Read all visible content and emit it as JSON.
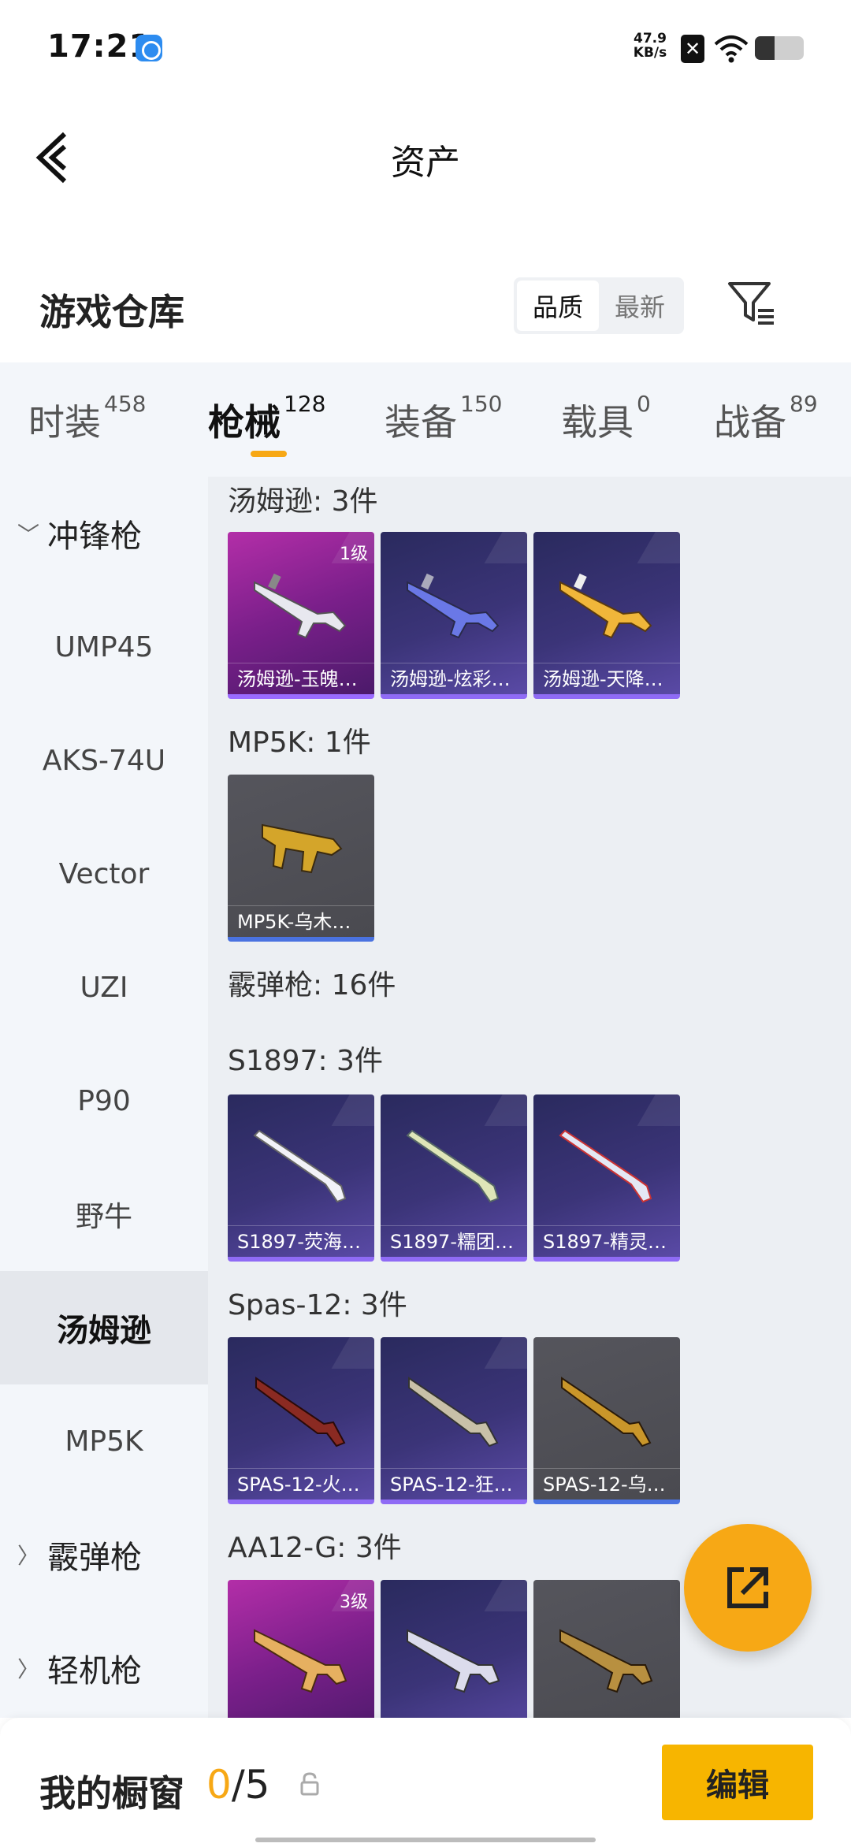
{
  "status_bar": {
    "time": "17:21",
    "speed_value": "47.9",
    "speed_unit": "KB/s",
    "icons": [
      "app-icon",
      "x-icon",
      "wifi-icon",
      "battery-icon"
    ]
  },
  "header": {
    "title": "资产",
    "back_icon": "chevron-left-icon"
  },
  "warehouse": {
    "title": "游戏仓库",
    "sort_options": [
      "品质",
      "最新"
    ],
    "sort_selected": "品质",
    "filter_icon": "filter-icon"
  },
  "tabs": [
    {
      "label": "时装",
      "count": "458"
    },
    {
      "label": "枪械",
      "count": "128",
      "active": true
    },
    {
      "label": "装备",
      "count": "150"
    },
    {
      "label": "载具",
      "count": "0"
    },
    {
      "label": "战备",
      "count": "89"
    }
  ],
  "sidebar": {
    "items": [
      {
        "label": "冲锋枪",
        "type": "group",
        "expanded": true
      },
      {
        "label": "UMP45"
      },
      {
        "label": "AKS-74U"
      },
      {
        "label": "Vector"
      },
      {
        "label": "UZI"
      },
      {
        "label": "P90"
      },
      {
        "label": "野牛"
      },
      {
        "label": "汤姆逊",
        "active": true
      },
      {
        "label": "MP5K"
      },
      {
        "label": "霰弹枪",
        "type": "group",
        "expanded": false
      },
      {
        "label": "轻机枪",
        "type": "group",
        "expanded": false
      }
    ]
  },
  "sections": [
    {
      "title": "汤姆逊: 3件",
      "items": [
        {
          "name": "汤姆逊-玉魄…",
          "level": "1级",
          "rarity": "pink"
        },
        {
          "name": "汤姆逊-炫彩…",
          "rarity": "blue"
        },
        {
          "name": "汤姆逊-天降…",
          "rarity": "blue"
        }
      ]
    },
    {
      "title": "MP5K: 1件",
      "items": [
        {
          "name": "MP5K-乌木…",
          "rarity": "gray"
        }
      ]
    },
    {
      "title": "霰弹枪: 16件",
      "items": []
    },
    {
      "title": "S1897: 3件",
      "items": [
        {
          "name": "S1897-荧海…",
          "rarity": "blue"
        },
        {
          "name": "S1897-糯团…",
          "rarity": "blue"
        },
        {
          "name": "S1897-精灵…",
          "rarity": "blue"
        }
      ]
    },
    {
      "title": "Spas-12: 3件",
      "items": [
        {
          "name": "SPAS-12-火…",
          "rarity": "blue"
        },
        {
          "name": "SPAS-12-狂…",
          "rarity": "blue"
        },
        {
          "name": "SPAS-12-乌…",
          "rarity": "gray"
        }
      ]
    },
    {
      "title": "AA12-G: 3件",
      "items": [
        {
          "name": "",
          "level": "3级",
          "rarity": "pink"
        },
        {
          "name": "",
          "rarity": "blue"
        },
        {
          "name": "",
          "rarity": "gray"
        }
      ]
    }
  ],
  "fab": {
    "icon": "share-icon"
  },
  "bottom_bar": {
    "label": "我的橱窗",
    "current": "0",
    "total": "/5",
    "lock_icon": "lock-icon",
    "edit_label": "编辑"
  },
  "colors": {
    "accent": "#f7a815",
    "pink_rarity": "#9a2a9e",
    "blue_rarity": "#3b3478",
    "gray_rarity": "#4f4f55"
  }
}
